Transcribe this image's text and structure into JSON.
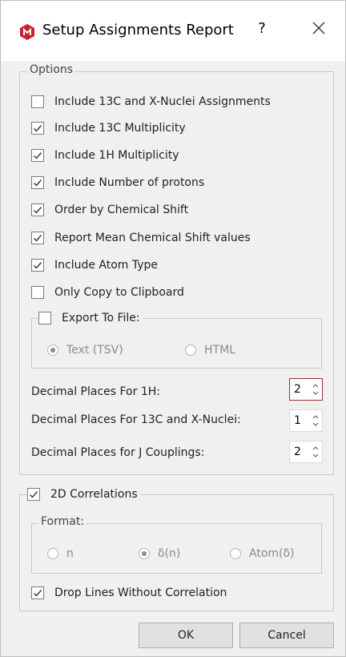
{
  "window": {
    "title": "Setup Assignments Report",
    "help_label": "?",
    "icon": "mnova-app-icon",
    "close_icon": "close-icon"
  },
  "options": {
    "legend": "Options",
    "checkboxes": [
      {
        "label": "Include 13C and X-Nuclei Assignments",
        "checked": false
      },
      {
        "label": "Include 13C Multiplicity",
        "checked": true
      },
      {
        "label": "Include 1H Multiplicity",
        "checked": true
      },
      {
        "label": "Include Number of protons",
        "checked": true
      },
      {
        "label": "Order by Chemical Shift",
        "checked": true
      },
      {
        "label": "Report Mean Chemical Shift values",
        "checked": true
      },
      {
        "label": "Include Atom Type",
        "checked": true
      },
      {
        "label": "Only Copy to Clipboard",
        "checked": false
      }
    ],
    "export": {
      "label": "Export To File:",
      "checked": false,
      "radios": [
        {
          "label": "Text (TSV)",
          "selected": true
        },
        {
          "label": "HTML",
          "selected": false
        }
      ]
    },
    "decimals": [
      {
        "label": "Decimal Places For 1H:",
        "value": "2"
      },
      {
        "label": "Decimal Places For 13C and X-Nuclei:",
        "value": "1"
      },
      {
        "label": "Decimal Places for J Couplings:",
        "value": "2"
      }
    ]
  },
  "correlations": {
    "label": "2D Correlations",
    "checked": true,
    "format": {
      "legend": "Format:",
      "radios": [
        {
          "label": "n",
          "selected": false
        },
        {
          "label": "δ(n)",
          "selected": true
        },
        {
          "label": "Atom(δ)",
          "selected": false
        }
      ]
    },
    "drop_lines": {
      "label": "Drop Lines Without Correlation",
      "checked": true
    }
  },
  "buttons": {
    "ok": "OK",
    "cancel": "Cancel"
  },
  "colors": {
    "accent_icon": "#c8202f",
    "focus_border": "#a52a2a"
  }
}
